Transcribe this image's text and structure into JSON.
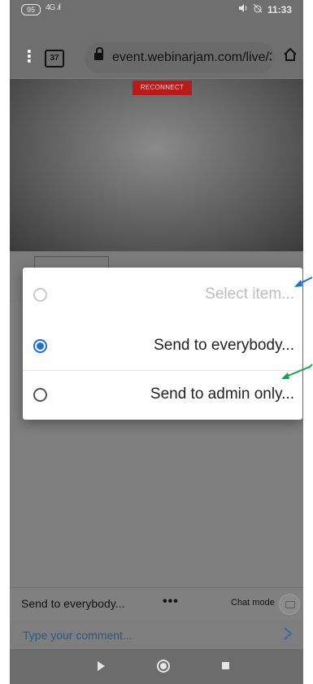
{
  "status_bar": {
    "battery": "95",
    "signal": "4G .ıl",
    "icons": [
      "mute-icon",
      "alarm-off-icon"
    ],
    "time": "11:33"
  },
  "browser": {
    "tab_count": "37",
    "url": "event.webinarjam.com/live/3"
  },
  "video": {
    "reconnect_label": "RECONNECT"
  },
  "dialog": {
    "options": [
      {
        "label": "Select item...",
        "selected": false,
        "disabled": true
      },
      {
        "label": "Send to everybody...",
        "selected": true,
        "disabled": false
      },
      {
        "label": "Send to admin only...",
        "selected": false,
        "disabled": false
      }
    ]
  },
  "chat": {
    "send_target": "Send to everybody...",
    "more": "•••",
    "mode_label": "Chat mode",
    "comment_placeholder": "Type your comment..."
  },
  "colors": {
    "accent": "#1e6fd9",
    "annotation_blue": "#1f6fd1",
    "annotation_green": "#17a34a",
    "reconnect": "#b81b1b"
  }
}
